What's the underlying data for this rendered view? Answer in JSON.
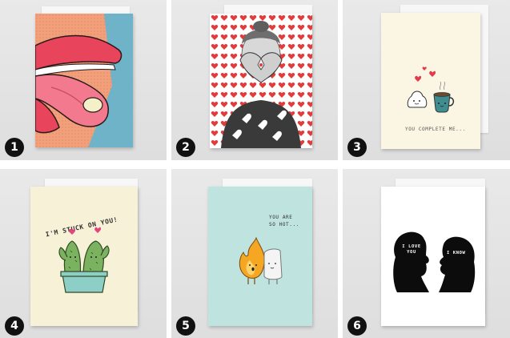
{
  "cards": [
    {
      "number": "1",
      "caption": "",
      "colors": {
        "bg_left": "#f59a6d",
        "bg_right": "#6fb3c8",
        "lip": "#e8455c",
        "tongue": "#f2798e"
      }
    },
    {
      "number": "2",
      "caption": "",
      "colors": {
        "heart": "#e23b3b",
        "bg": "#ffffff"
      }
    },
    {
      "number": "3",
      "caption": "YOU COMPLETE ME...",
      "colors": {
        "bg": "#fbf6e4",
        "mug": "#3f8d91",
        "heart": "#e13a4a"
      }
    },
    {
      "number": "4",
      "caption": "I'M STUCK ON YOU!",
      "colors": {
        "bg": "#f7f1d8",
        "cactus": "#7bb25f",
        "pot": "#8dcfc6"
      }
    },
    {
      "number": "5",
      "caption": "YOU ARE SO HOT...",
      "colors": {
        "bg": "#bfe3df",
        "flame": "#f5a623"
      }
    },
    {
      "number": "6",
      "caption_left": "I LOVE YOU",
      "caption_right": "I KNOW",
      "colors": {
        "bg": "#ffffff",
        "silhouette": "#0c0c0c"
      }
    }
  ]
}
